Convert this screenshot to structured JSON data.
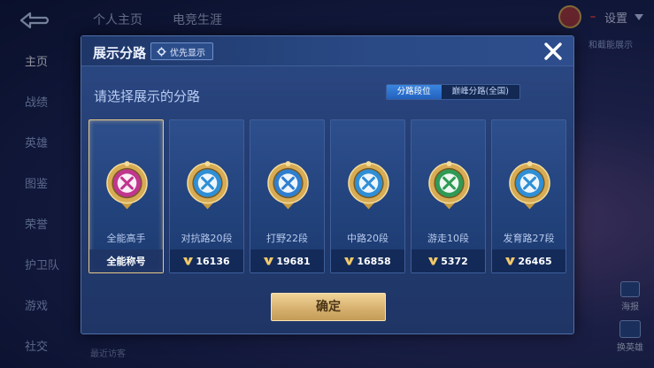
{
  "background": {
    "tabs": [
      "个人主页",
      "电竞生涯"
    ],
    "settings_label": "设置",
    "badge": "",
    "peek_text": "和截能展示",
    "nav": [
      "主页",
      "战绩",
      "英雄",
      "图鉴",
      "荣誉",
      "护卫队",
      "游戏",
      "社交"
    ],
    "right_buttons": [
      "海报",
      "换英雄"
    ],
    "bottom_hint": "最近访客"
  },
  "modal": {
    "title": "展示分路",
    "priority_label": "优先显示",
    "subtitle": "请选择展示的分路",
    "segments": [
      {
        "label": "分路段位",
        "active": true
      },
      {
        "label": "巅峰分路(全国)",
        "active": false
      }
    ],
    "cards": [
      {
        "name": "全能高手",
        "footer": "全能称号",
        "emblem": "allround-emblem-icon",
        "color": "#c0368f",
        "selected": true,
        "show_v": false
      },
      {
        "name": "对抗路20段",
        "footer": "16136",
        "emblem": "clash-lane-emblem-icon",
        "color": "#2f8fd6",
        "selected": false,
        "show_v": true
      },
      {
        "name": "打野22段",
        "footer": "19681",
        "emblem": "jungle-emblem-icon",
        "color": "#2f7fd0",
        "selected": false,
        "show_v": true
      },
      {
        "name": "中路20段",
        "footer": "16858",
        "emblem": "mid-lane-emblem-icon",
        "color": "#2f8fd6",
        "selected": false,
        "show_v": true
      },
      {
        "name": "游走10段",
        "footer": "5372",
        "emblem": "roam-emblem-icon",
        "color": "#2f9a55",
        "selected": false,
        "show_v": true
      },
      {
        "name": "发育路27段",
        "footer": "26465",
        "emblem": "farm-lane-emblem-icon",
        "color": "#2f8fd6",
        "selected": false,
        "show_v": true
      }
    ],
    "confirm_label": "确定"
  },
  "colors": {
    "gold": "#e8c98a",
    "accent_blue": "#2f7fd8",
    "panel": "#243d73"
  }
}
